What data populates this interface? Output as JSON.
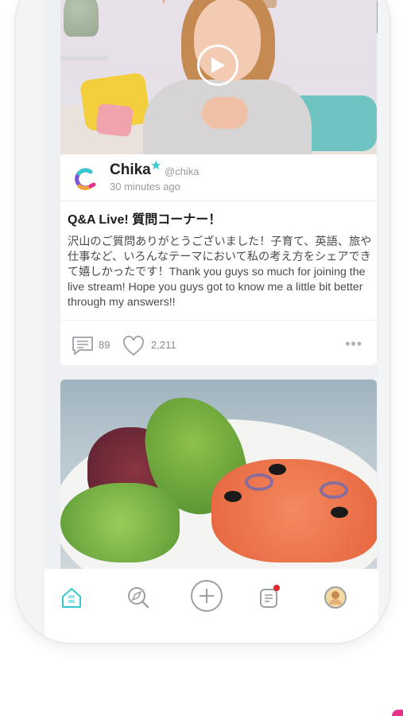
{
  "colors": {
    "accent": "#38c9d0",
    "badge": "#e5252a",
    "text_primary": "#1f1f1f",
    "text_secondary": "#9a9a9a"
  },
  "feed": {
    "posts": [
      {
        "author_name": "Chika",
        "verified_icon": "star-icon",
        "handle": "@chika",
        "time": "30 minutes ago",
        "title": "Q&A Live! 質問コーナー！",
        "body": "沢山のご質問ありがとうございました！子育て、英語、旅や仕事など、いろんなテーマにおいて私の考え方をシェアできて嬉しかったです！Thank you guys so much for joining the live stream! Hope you guys got to know me a little bit better through my answers!!",
        "comments": "89",
        "likes": "2,211",
        "media_type": "video",
        "play_icon": "play-icon"
      },
      {
        "media_type": "image"
      }
    ]
  },
  "tabbar": {
    "items": [
      {
        "icon": "home-icon",
        "active": true
      },
      {
        "icon": "explore-icon",
        "active": false
      },
      {
        "icon": "add-icon",
        "active": false
      },
      {
        "icon": "notifications-icon",
        "active": false,
        "has_badge": true
      },
      {
        "icon": "profile-avatar",
        "active": false
      }
    ]
  }
}
